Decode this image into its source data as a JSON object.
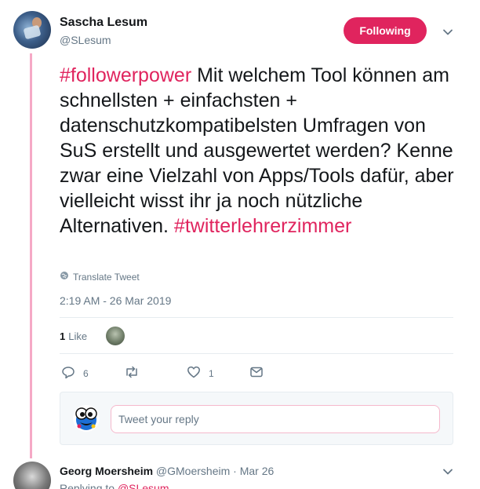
{
  "tweet": {
    "display_name": "Sascha Lesum",
    "handle": "@SLesum",
    "follow_label": "Following",
    "text_tag1": "#followerpower",
    "text_body": " Mit welchem Tool können am schnellsten + einfachsten + datenschutzkompatibelsten Umfragen von SuS erstellt und ausgewertet werden? Kenne zwar eine Vielzahl von Apps/Tools dafür, aber vielleicht wisst ihr ja noch nützliche Alternativen. ",
    "text_tag2": "#twitterlehrerzimmer",
    "translate_label": "Translate Tweet",
    "timestamp": "2:19 AM - 26 Mar 2019",
    "likes_count": "1",
    "likes_label": "Like"
  },
  "actions": {
    "reply_count": "6",
    "retweet_count": "",
    "like_count": "1"
  },
  "reply_box": {
    "placeholder": "Tweet your reply"
  },
  "next_reply": {
    "display_name": "Georg Moersheim",
    "handle": "@GMoersheim",
    "separator": " · ",
    "date": "Mar 26",
    "replying_prefix": "Replying to ",
    "replying_handle": "@SLesum"
  },
  "colors": {
    "accent": "#e0245e",
    "muted": "#657786",
    "thread_line": "#f5a9c6"
  },
  "icons": [
    "chevron-down-icon",
    "globe-icon",
    "reply-icon",
    "retweet-icon",
    "heart-icon",
    "mail-icon"
  ]
}
